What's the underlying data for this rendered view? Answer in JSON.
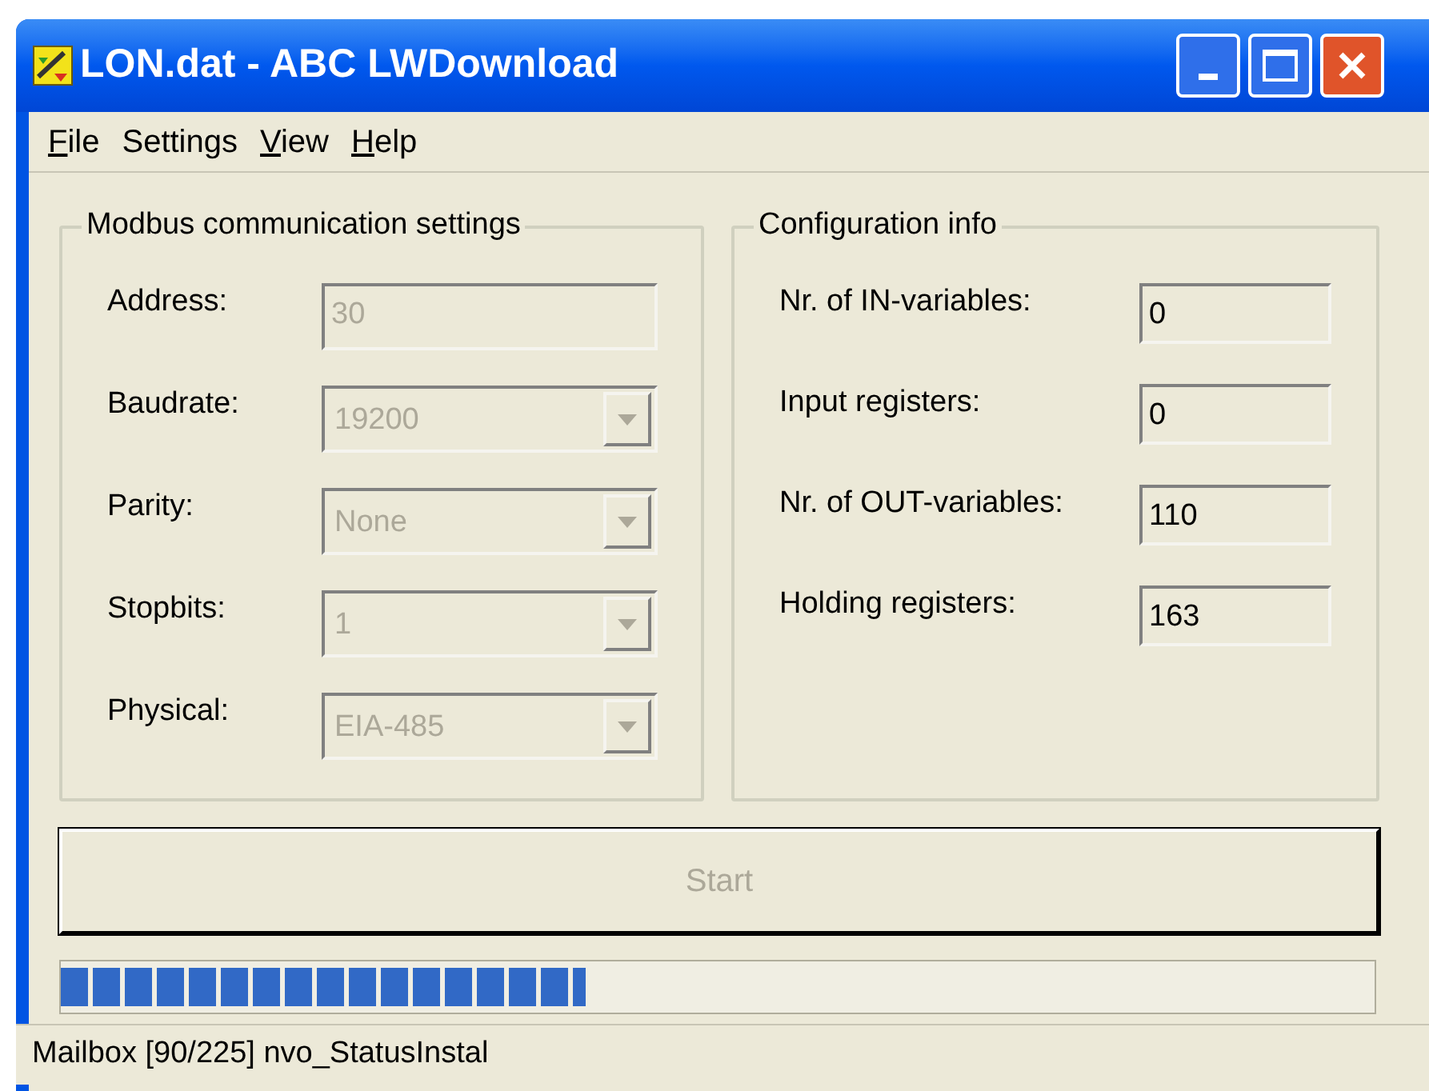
{
  "window": {
    "title": "LON.dat - ABC LWDownload"
  },
  "menu": [
    {
      "label": "File",
      "mnemonic": true
    },
    {
      "label": "Settings",
      "mnemonic": false
    },
    {
      "label": "View",
      "mnemonic": true
    },
    {
      "label": "Help",
      "mnemonic": true
    }
  ],
  "modbus_group": {
    "title": "Modbus communication settings",
    "fields": [
      {
        "label": "Address:",
        "kind": "text",
        "value": "30",
        "disabled": true
      },
      {
        "label": "Baudrate:",
        "kind": "dropdown",
        "value": "19200",
        "disabled": true
      },
      {
        "label": "Parity:",
        "kind": "dropdown",
        "value": "None",
        "disabled": true
      },
      {
        "label": "Stopbits:",
        "kind": "dropdown",
        "value": "1",
        "disabled": true
      },
      {
        "label": "Physical:",
        "kind": "dropdown",
        "value": "EIA-485",
        "disabled": true
      }
    ]
  },
  "config_group": {
    "title": "Configuration info",
    "fields": [
      {
        "label": "Nr. of IN-variables:",
        "kind": "text",
        "value": "0",
        "disabled": false
      },
      {
        "label": "Input registers:",
        "kind": "text",
        "value": "0",
        "disabled": false
      },
      {
        "label": "Nr. of OUT-variables:",
        "kind": "text",
        "value": "110",
        "disabled": false
      },
      {
        "label": "Holding registers:",
        "kind": "text",
        "value": "163",
        "disabled": false
      }
    ]
  },
  "start_button": {
    "label": "Start",
    "disabled": true
  },
  "progress": {
    "level": 0.4
  },
  "status_bar": {
    "text": "Mailbox [90/225] nvo_StatusInstal"
  }
}
